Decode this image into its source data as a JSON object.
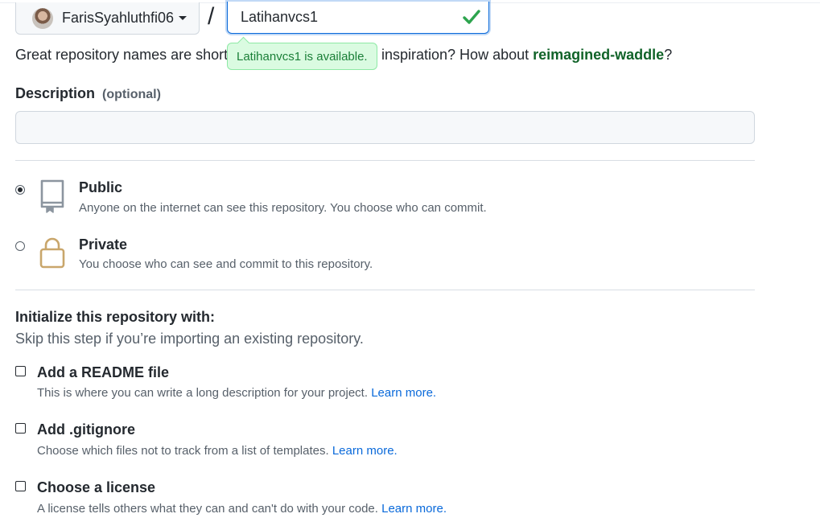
{
  "owner": {
    "name": "FarisSyahluthfi06"
  },
  "separator": "/",
  "repo_name": {
    "value": "Latihanvcs1"
  },
  "availability": {
    "message": "Latihanvcs1 is available."
  },
  "hint": {
    "prefix": "Great repository names are short and memorable. Need",
    "middle": "inspiration? How about",
    "suggestion": "reimagined-waddle",
    "suffix": "?"
  },
  "description": {
    "label": "Description",
    "optional": "(optional)",
    "value": ""
  },
  "visibility": [
    {
      "title": "Public",
      "desc": "Anyone on the internet can see this repository. You choose who can commit.",
      "checked": true,
      "icon": "repo-icon"
    },
    {
      "title": "Private",
      "desc": "You choose who can see and commit to this repository.",
      "checked": false,
      "icon": "lock-icon"
    }
  ],
  "init": {
    "title": "Initialize this repository with:",
    "subtitle": "Skip this step if you’re importing an existing repository.",
    "options": [
      {
        "title": "Add a README file",
        "desc": "This is where you can write a long description for your project.",
        "link": "Learn more."
      },
      {
        "title": "Add .gitignore",
        "desc": "Choose which files not to track from a list of templates.",
        "link": "Learn more."
      },
      {
        "title": "Choose a license",
        "desc": "A license tells others what they can and can't do with your code.",
        "link": "Learn more."
      }
    ]
  },
  "colors": {
    "accent": "#0969da",
    "success": "#1a7f37",
    "success_bg": "#dafbe1"
  }
}
